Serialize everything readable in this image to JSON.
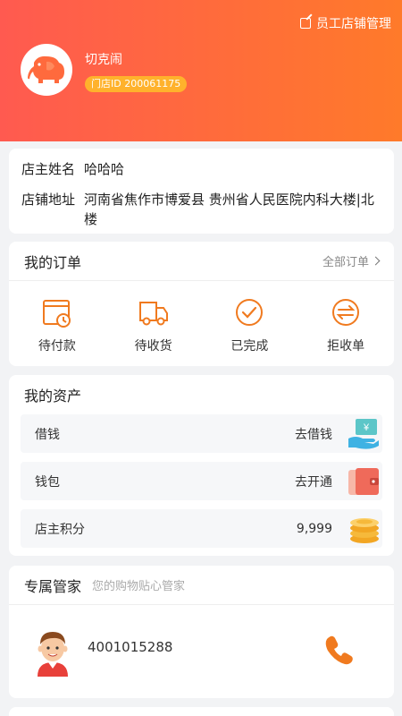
{
  "header": {
    "manage_label": "员工店铺管理",
    "user_name": "切克闹",
    "store_id_label": "门店ID 200061175"
  },
  "info": {
    "owner_key": "店主姓名",
    "owner_value": "哈哈哈",
    "address_key": "店铺地址",
    "address_value": "河南省焦作市博爱县 贵州省人民医院内科大楼|北楼"
  },
  "orders": {
    "title": "我的订单",
    "all_label": "全部订单",
    "items": [
      {
        "label": "待付款",
        "icon": "pending-payment-icon"
      },
      {
        "label": "待收货",
        "icon": "truck-icon"
      },
      {
        "label": "已完成",
        "icon": "check-circle-icon"
      },
      {
        "label": "拒收单",
        "icon": "exchange-icon"
      }
    ]
  },
  "assets": {
    "title": "我的资产",
    "rows": [
      {
        "key": "借钱",
        "value": "去借钱",
        "icon": "loan-hand-icon"
      },
      {
        "key": "钱包",
        "value": "去开通",
        "icon": "wallet-icon"
      },
      {
        "key": "店主积分",
        "value": "9,999",
        "icon": "coins-icon"
      }
    ]
  },
  "butler": {
    "title": "专属管家",
    "subtitle": "您的购物贴心管家",
    "phone": "4001015288"
  },
  "colors": {
    "header_start": "#ff5a50",
    "header_end": "#ff7a2a",
    "accent": "#f07a1f",
    "badge": "#ffb22c"
  }
}
